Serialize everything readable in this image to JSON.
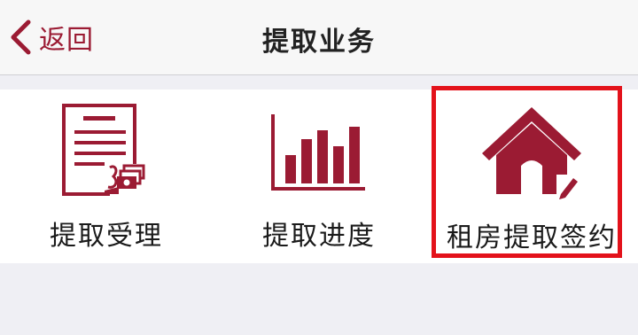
{
  "navbar": {
    "back_label": "返回",
    "title": "提取业务"
  },
  "tiles": [
    {
      "label": "提取受理",
      "icon": "document-money-icon"
    },
    {
      "label": "提取进度",
      "icon": "bar-chart-icon"
    },
    {
      "label": "租房提取签约",
      "icon": "house-edit-icon",
      "highlighted": true
    }
  ],
  "colors": {
    "accent": "#9b1b33",
    "highlight_border": "#e3121b",
    "background": "#efeff4"
  }
}
